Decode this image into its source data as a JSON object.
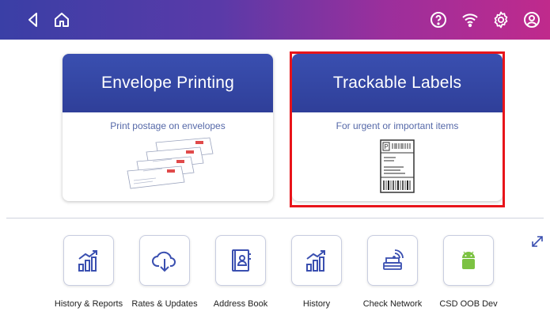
{
  "header": {
    "icons": [
      "back-icon",
      "home-icon",
      "help-icon",
      "wifi-icon",
      "settings-icon",
      "account-icon"
    ],
    "gradient_colors": [
      "#3a3fa6",
      "#9b2f9c",
      "#c02a8c"
    ]
  },
  "cards": [
    {
      "title": "Envelope Printing",
      "subtitle": "Print postage on envelopes"
    },
    {
      "title": "Trackable Labels",
      "subtitle": "For urgent or important items"
    }
  ],
  "apps": [
    {
      "label": "History & Reports",
      "icon": "bar-chart-trend-icon"
    },
    {
      "label": "Rates & Updates",
      "icon": "cloud-download-icon"
    },
    {
      "label": "Address Book",
      "icon": "address-book-icon"
    },
    {
      "label": "History",
      "icon": "bar-chart-trend-icon"
    },
    {
      "label": "Check Network",
      "icon": "network-icon"
    },
    {
      "label": "CSD OOB Dev",
      "icon": "android-icon"
    }
  ],
  "colors": {
    "accent": "#3a4fb0",
    "highlight": "#e8141a",
    "android": "#7cc242"
  }
}
